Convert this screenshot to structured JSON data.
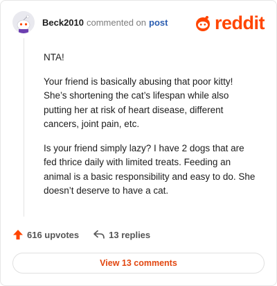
{
  "comment": {
    "author": "Beck2010",
    "meta_text": "commented on",
    "post_link_text": "post",
    "paragraphs": [
      "NTA!",
      "Your friend is basically abusing that poor kitty! She’s shortening the cat’s lifespan while also putting her at risk of heart disease, different cancers, joint pain, etc.",
      "Is your friend simply lazy? I have 2 dogs that are fed thrice daily with limited treats. Feeding an animal is a basic responsibility and easy to do. She doesn’t deserve to have a cat."
    ]
  },
  "brand": {
    "logo_text": "reddit",
    "color": "#ff4500"
  },
  "actions": {
    "upvotes_label": "616 upvotes",
    "replies_label": "13 replies",
    "upvote_color": "#ff4500"
  },
  "footer": {
    "view_comments_label": "View 13 comments"
  },
  "icons": {
    "avatar": "snoo-avatar",
    "logo": "reddit-logo-icon",
    "upvote": "upvote-arrow-icon",
    "reply": "reply-arrow-icon"
  }
}
